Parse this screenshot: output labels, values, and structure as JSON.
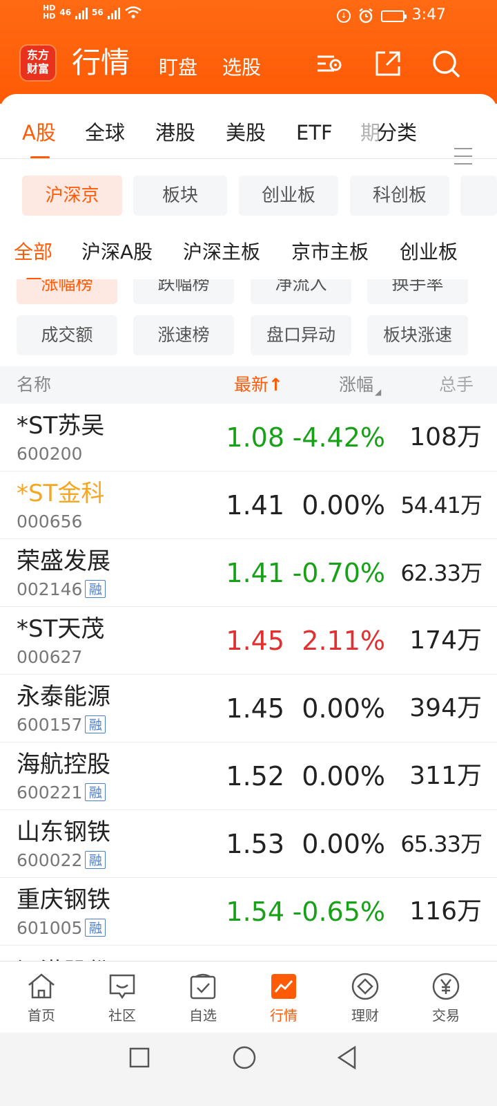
{
  "status_bar": {
    "hd1": "HD",
    "hd2": "HD",
    "sig1": "46",
    "sig2": "56",
    "time": "3:47"
  },
  "header": {
    "logo": "东方\n财富",
    "logo_line1": "东方",
    "logo_line2": "财富",
    "title": "行情",
    "tab_watch": "盯盘",
    "tab_pick": "选股",
    "icons": [
      "settings-icon",
      "share-icon",
      "search-icon"
    ]
  },
  "market_tabs": [
    "A股",
    "全球",
    "港股",
    "美股",
    "ETF",
    "期",
    "分类"
  ],
  "chips": [
    "沪深京",
    "板块",
    "创业板",
    "科创板"
  ],
  "sub_tabs": [
    "全部",
    "沪深A股",
    "沪深主板",
    "京市主板",
    "创业板"
  ],
  "rank_chips": [
    "涨幅榜",
    "跌幅榜",
    "净流入",
    "换手率",
    "成交额",
    "涨速榜",
    "盘口异动",
    "板块涨速"
  ],
  "table": {
    "headers": {
      "name": "名称",
      "latest": "最新",
      "latest_arrow": "↑",
      "change": "涨幅",
      "volume": "总手"
    },
    "rows": [
      {
        "name": "*ST苏吴",
        "code": "600200",
        "margin": "",
        "latest": "1.08",
        "change": "-4.42%",
        "volume": "108万",
        "color": "#18a118"
      },
      {
        "name": "*ST金科",
        "code": "000656",
        "margin": "",
        "latest": "1.41",
        "change": "0.00%",
        "volume": "54.41万",
        "color": "#222222"
      },
      {
        "name": "荣盛发展",
        "code": "002146",
        "margin": "融",
        "latest": "1.41",
        "change": "-0.70%",
        "volume": "62.33万",
        "color": "#18a118"
      },
      {
        "name": "*ST天茂",
        "code": "000627",
        "margin": "",
        "latest": "1.45",
        "change": "2.11%",
        "volume": "174万",
        "color": "#e03030"
      },
      {
        "name": "永泰能源",
        "code": "600157",
        "margin": "融",
        "latest": "1.45",
        "change": "0.00%",
        "volume": "394万",
        "color": "#222222"
      },
      {
        "name": "海航控股",
        "code": "600221",
        "margin": "融",
        "latest": "1.52",
        "change": "0.00%",
        "volume": "311万",
        "color": "#222222"
      },
      {
        "name": "山东钢铁",
        "code": "600022",
        "margin": "融",
        "latest": "1.53",
        "change": "0.00%",
        "volume": "65.33万",
        "color": "#222222"
      },
      {
        "name": "重庆钢铁",
        "code": "601005",
        "margin": "融",
        "latest": "1.54",
        "change": "-0.65%",
        "volume": "116万",
        "color": "#18a118"
      }
    ],
    "partial_row_name": "江港股份"
  },
  "bottom_nav": [
    "首页",
    "社区",
    "自选",
    "行情",
    "理财",
    "交易"
  ],
  "colors": {
    "brand": "#ff5a06",
    "up": "#e03030",
    "down": "#18a118",
    "highlight": "#f5a623"
  }
}
